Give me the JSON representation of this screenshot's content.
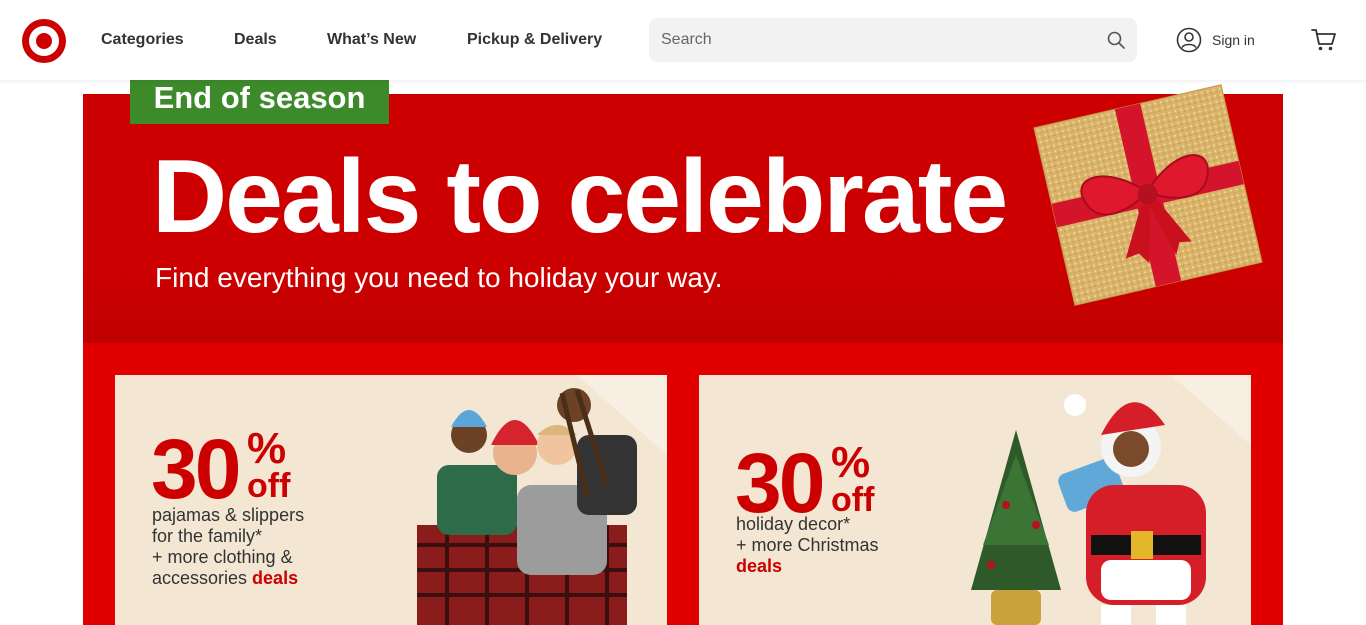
{
  "header": {
    "nav": [
      "Categories",
      "Deals",
      "What’s New",
      "Pickup & Delivery"
    ],
    "search_placeholder": "Search",
    "sign_in": "Sign in"
  },
  "banner": {
    "badge": "End of season",
    "headline": "Deals to celebrate",
    "subhead": "Find everything you need to holiday your way."
  },
  "cards": [
    {
      "percent": "30",
      "percent_sign": "%",
      "off": "off",
      "line1": "pajamas & slippers",
      "line2": "for the family*",
      "line3": "+ more clothing &",
      "line4": "accessories ",
      "link": "deals"
    },
    {
      "percent": "30",
      "percent_sign": "%",
      "off": "off",
      "line1": "holiday decor*",
      "line2": "+ more Christmas",
      "link": "deals"
    }
  ],
  "colors": {
    "brand_red": "#cc0000",
    "badge_green": "#3d8a2a",
    "card_bg": "#f3e7d4"
  },
  "icons": [
    "target-logo",
    "search-icon",
    "account-icon",
    "cart-icon",
    "gift-box-image"
  ]
}
